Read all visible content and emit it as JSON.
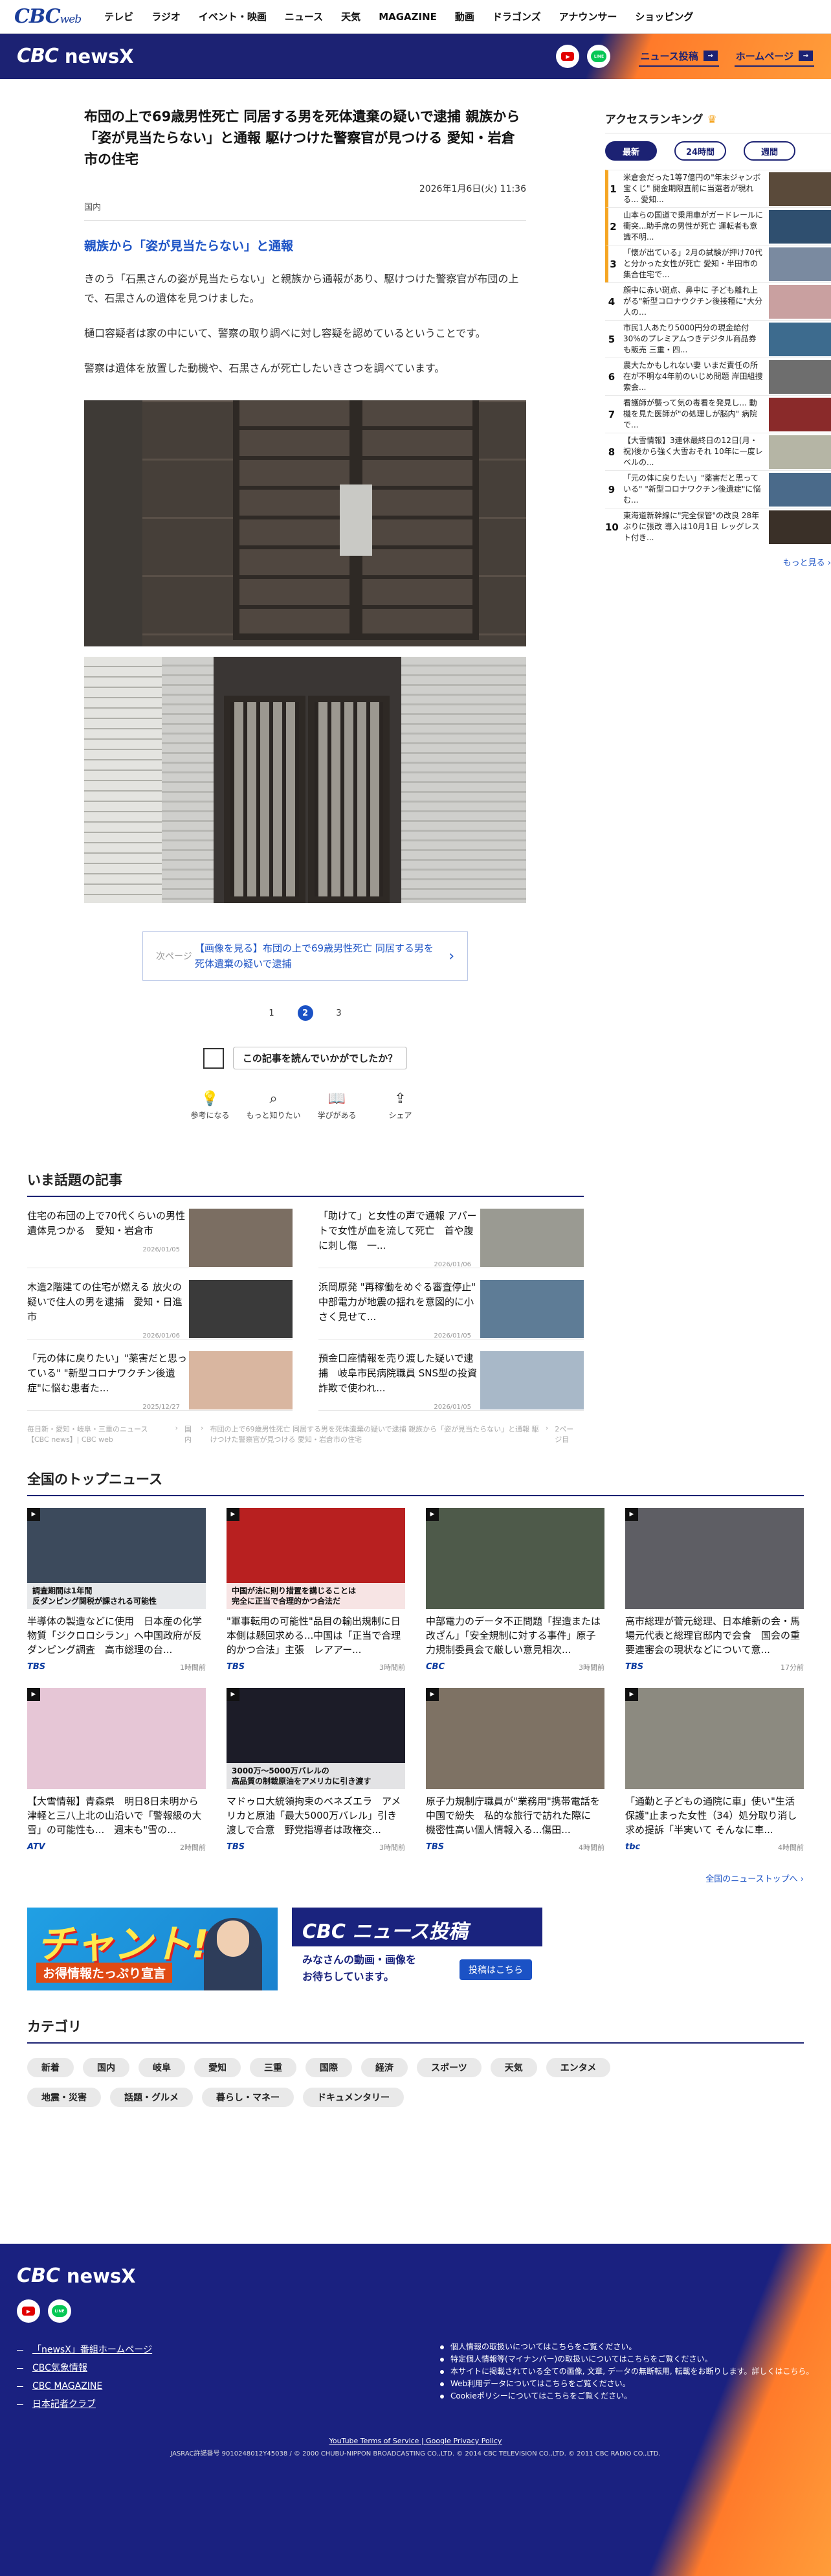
{
  "topnav": {
    "brand": "CBC",
    "brand_suffix": "web",
    "items": [
      "テレビ",
      "ラジオ",
      "イベント・映画",
      "ニュース",
      "天気",
      "MAGAZINE",
      "動画",
      "ドラゴンズ",
      "アナウンサー",
      "ショッピング"
    ]
  },
  "header": {
    "logo_cbc": "CBC",
    "logo_news": "newsX",
    "post_button": "ニュース投稿",
    "home_button": "ホームページ",
    "youtube": "▶",
    "line": "LINE"
  },
  "article": {
    "title": "布団の上で69歳男性死亡 同居する男を死体遺棄の疑いで逮捕 親族から「姿が見当たらない」と通報 駆けつけた警察官が見つける 愛知・岩倉市の住宅",
    "date": "2026年1月6日(火) 11:36",
    "category": "国内",
    "subhead": "親族から「姿が見当たらない」と通報",
    "para1": "きのう「石黒さんの姿が見当たらない」と親族から通報があり、駆けつけた警察官が布団の上で、石黒さんの遺体を見つけました。",
    "para2": "樋口容疑者は家の中にいて、警察の取り調べに対し容疑を認めているということです。",
    "para3": "警察は遺体を放置した動機や、石黒さんが死亡したいきさつを調べています。",
    "next_label": "次ページ",
    "next_text": "【画像を見る】布団の上で69歳男性死亡 同居する男を死体遺棄の疑いで逮捕",
    "pages": [
      "1",
      "2",
      "3"
    ],
    "ask": "この記事を読んでいかがでしたか？",
    "reactions": [
      {
        "icon": "bulb-icon",
        "label": "参考になる"
      },
      {
        "icon": "search-icon",
        "label": "もっと知りたい"
      },
      {
        "icon": "book-icon",
        "label": "学びがある"
      },
      {
        "icon": "share-icon",
        "label": "シェア"
      }
    ]
  },
  "ranking": {
    "title": "アクセスランキング",
    "tabs": [
      "最新",
      "24時間",
      "週間"
    ],
    "items": [
      {
        "n": "1",
        "t": "米倉会だった1等7億円の\"年末ジャンボ宝くじ\" 開金期限直前に当選者が現れる... 愛知..."
      },
      {
        "n": "2",
        "t": "山本らの国道で乗用車がガードレールに衝突...助手席の男性が死亡 運転者も意識不明..."
      },
      {
        "n": "3",
        "t": "「懐が出ている」2月の試験が押け70代と分かった女性が死亡 愛知・半田市の集合住宅で..."
      },
      {
        "n": "4",
        "t": "顔中に赤い斑点、鼻中に 子ども離れ上がる\"新型コロナウクチン後接種に\"大分人の…"
      },
      {
        "n": "5",
        "t": "市民1人あたり5000円分の現金給付30%のプレミアムつきデジタル商品券も販売 三重・四..."
      },
      {
        "n": "6",
        "t": "農大たかもしれない妻 いまだ責任の所在が不明な4年前のいじめ問題 岸田組捜索会..."
      },
      {
        "n": "7",
        "t": "看護師が襲って気の毒看を発見し... 動機を見た医師が\"の処理しが脳内\" 病院で..."
      },
      {
        "n": "8",
        "t": "【大雪情報】3連休最終日の12日(月・祝)後から強く大雪おそれ 10年に一度レベルの..."
      },
      {
        "n": "9",
        "t": "「元の体に戻りたい」\"薬害だと思っている\" \"新型コロナワクチン後遺症\"に悩む..."
      },
      {
        "n": "10",
        "t": "東海道新幹線に\"完全保管\"の改良 28年ぶりに張改 導入は10月1日 レッグレスト付き..."
      }
    ],
    "more": "もっと見る"
  },
  "topics": {
    "title": "いま話題の記事",
    "items": [
      {
        "t": "住宅の布団の上で70代くらいの男性遺体見つかる　愛知・岩倉市",
        "d": "2026/01/05"
      },
      {
        "t": "「助けて」と女性の声で通報 アパートで女性が血を流して死亡　首や腹に刺し傷　一...",
        "d": "2026/01/06"
      },
      {
        "t": "木造2階建ての住宅が燃える 放火の疑いで住人の男を逮捕　愛知・日進市",
        "d": "2026/01/06"
      },
      {
        "t": "浜岡原発 \"再稼働をめぐる審査停止\" 中部電力が地震の揺れを意図的に小さく見せて...",
        "d": "2026/01/05"
      },
      {
        "t": "「元の体に戻りたい」\"薬害だと思っている\" \"新型コロナワクチン後遺症\"に悩む患者た...",
        "d": "2025/12/27"
      },
      {
        "t": "預金口座情報を売り渡した疑いで逮捕　岐阜市民病院職員 SNS型の投資詐欺で使われ...",
        "d": "2026/01/05"
      }
    ],
    "breadcrumb": [
      "毎日新・愛知・岐阜・三重のニュース【CBC news】| CBC web",
      "国内",
      "布団の上で69歳男性死亡 同居する男を死体遺棄の疑いで逮捕 親族から「姿が見当たらない」と通報 駆けつけた警察官が見つける 愛知・岩倉市の住宅",
      "2ページ目"
    ]
  },
  "national": {
    "title": "全国のトップニュース",
    "items": [
      {
        "t": "半導体の製造などに使用　日本産の化学物質「ジクロロシラン」へ中国政府が反ダンピング調査　高市総理の台...",
        "src": "TBS",
        "d": "1時間前"
      },
      {
        "t": "\"軍事転用の可能性\"品目の輸出規制に日本側は懸回求める...中国は「正当で合理的かつ合法」主張　レアアー...",
        "src": "TBS",
        "d": "3時間前"
      },
      {
        "t": "中部電力のデータ不正問題「捏造または改ざん」「安全規制に対する事件」原子力規制委員会で厳しい意見相次...",
        "src": "CBC",
        "d": "3時間前"
      },
      {
        "t": "高市総理が菅元総理、日本維新の会・馬場元代表と総理官邸内で会食　国会の重要連審会の現状などについて意...",
        "src": "TBS",
        "d": "17分前"
      },
      {
        "t": "【大雪情報】青森県　明日8日未明から津軽と三八上北の山沿いで「警報級の大雪」の可能性も...　週末も\"雪の...",
        "src": "ATV",
        "d": "2時間前"
      },
      {
        "t": "マドゥロ大統領拘束のベネズエラ　アメリカと原油「最大5000万バレル」引き渡しで合意　野党指導者は政権交...",
        "src": "TBS",
        "d": "3時間前"
      },
      {
        "t": "原子力規制庁職員が\"業務用\"携帯電話を中国で紛失　私的な旅行で訪れた際に　機密性高い個人情報入る...傷田...",
        "src": "TBS",
        "d": "4時間前"
      },
      {
        "t": "「通勤と子どもの通院に車」使い\"生活保護\"止まった女性（34）処分取り消し求め提訴「半実いて そんなに車...",
        "src": "tbc",
        "d": "4時間前"
      }
    ],
    "thumb_captions": [
      "調査期間は1年間\n反ダンピング関税が課される可能性",
      "中国が法に則り措置を講じることは\n完全に正当で合理的かつ合法だ",
      "",
      "",
      "",
      "3000万〜5000万バレルの\n高品質の制裁原油をアメリカに引き渡す",
      "",
      ""
    ],
    "all": "全国のニューストップへ"
  },
  "banners": {
    "b1_title": "チャント!",
    "b1_sub": "お得情報たっぷり宣言",
    "b2_title": "CBC ニュース投稿",
    "b2_sub": "みなさんの動画・画像を\nお待ちしています。",
    "b2_btn": "投稿はこちら"
  },
  "categories": {
    "title": "カテゴリ",
    "items": [
      "新着",
      "国内",
      "岐阜",
      "愛知",
      "三重",
      "国際",
      "経済",
      "スポーツ",
      "天気",
      "エンタメ",
      "地震・災害",
      "話題・グルメ",
      "暮らし・マネー",
      "ドキュメンタリー"
    ]
  },
  "footer": {
    "logo_cbc": "CBC",
    "logo_news": "newsX",
    "links": [
      "「newsX」番組ホームページ",
      "CBC気象情報",
      "CBC MAGAZINE",
      "日本記者クラブ"
    ],
    "policies": [
      "個人情報の取扱いについてはこちらをご覧ください。",
      "特定個人情報等(マイナンバー)の取扱いについてはこちらをご覧ください。",
      "本サイトに掲載されている全ての画像, 文章, データの無断転用, 転載をお断りします。詳しくはこちら。",
      "Web利用データについてはこちらをご覧ください。",
      "Cookieポリシーについてはこちらをご覧ください。"
    ],
    "terms": "YouTube Terms of Service",
    "privacy": "Google Privacy Policy",
    "copyright": "JASRAC許諾番号 9010248012Y45038 / © 2000 CHUBU-NIPPON BROADCASTING CO.,LTD. © 2014 CBC TELEVISION CO.,LTD. © 2011 CBC RADIO CO.,LTD."
  }
}
